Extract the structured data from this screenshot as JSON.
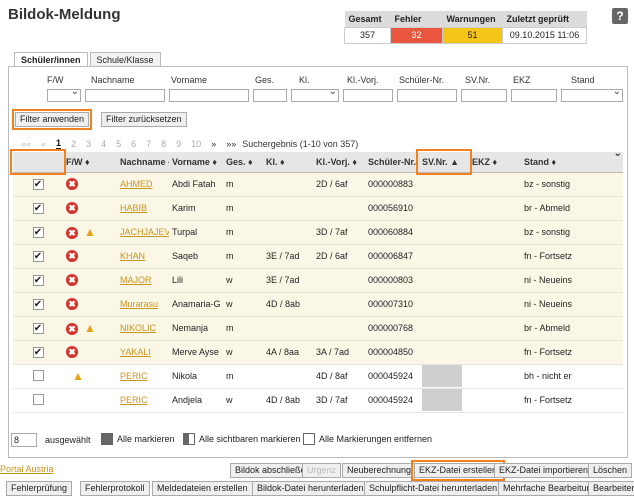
{
  "title": "Bildok-Meldung",
  "stats": {
    "headers": [
      "Gesamt",
      "Fehler",
      "Warnungen",
      "Zuletzt geprüft"
    ],
    "values": [
      "357",
      "32",
      "51",
      "09.10.2015 11:06"
    ],
    "colors": {
      "error": "#e9573f",
      "warning": "#f5c518"
    }
  },
  "help_label": "?",
  "tabs": [
    "Schüler/innen",
    "Schule/Klasse"
  ],
  "filters": {
    "labels": [
      "F/W",
      "Nachname",
      "Vorname",
      "Ges.",
      "Kl.",
      "Kl.-Vorj.",
      "Schüler-Nr.",
      "SV.Nr.",
      "EKZ",
      "Stand"
    ],
    "apply_label": "Filter anwenden",
    "reset_label": "Filter zurücksetzen"
  },
  "pager": {
    "first": "««",
    "prev": "«",
    "pages": [
      "1",
      "2",
      "3",
      "4",
      "5",
      "6",
      "7",
      "8",
      "9",
      "10"
    ],
    "next": "»",
    "last": "»»",
    "result": "Suchergebnis (1-10 von 357)"
  },
  "table": {
    "columns": [
      "",
      "F/W ♦",
      "Nachname ♦",
      "Vorname ♦",
      "Ges. ♦",
      "Kl. ♦",
      "Kl.-Vorj. ♦",
      "Schüler-Nr. ♦",
      "SV.Nr. ▲",
      "EKZ ♦",
      "Stand ♦"
    ],
    "rows": [
      {
        "checked": "✔",
        "err": "✖",
        "warn": "",
        "nachname": "AHMED",
        "vorname": "Abdi Fatah",
        "ges": "m",
        "kl": "",
        "vorj": "2D / 6af",
        "nr": "000000883",
        "sv": "",
        "ekz": "",
        "stand": "bz - sonstig"
      },
      {
        "checked": "✔",
        "err": "✖",
        "warn": "",
        "nachname": "HABIB",
        "vorname": "Karim",
        "ges": "m",
        "kl": "",
        "vorj": "",
        "nr": "000056910",
        "sv": "",
        "ekz": "",
        "stand": "br - Abmeld"
      },
      {
        "checked": "✔",
        "err": "✖",
        "warn": "▲",
        "nachname": "JACHJAJEV",
        "vorname": "Turpal",
        "ges": "m",
        "kl": "",
        "vorj": "3D / 7af",
        "nr": "000060884",
        "sv": "",
        "ekz": "",
        "stand": "bz - sonstig"
      },
      {
        "checked": "✔",
        "err": "✖",
        "warn": "",
        "nachname": "KHAN",
        "vorname": "Saqeb",
        "ges": "m",
        "kl": "3E / 7ad",
        "vorj": "2D / 6af",
        "nr": "000006847",
        "sv": "",
        "ekz": "",
        "stand": "fn - Fortsetz"
      },
      {
        "checked": "✔",
        "err": "✖",
        "warn": "",
        "nachname": "MAJOR",
        "vorname": "Lili",
        "ges": "w",
        "kl": "3E / 7ad",
        "vorj": "",
        "nr": "000000803",
        "sv": "",
        "ekz": "",
        "stand": "ni - Neueins"
      },
      {
        "checked": "✔",
        "err": "✖",
        "warn": "",
        "nachname": "Murarasu",
        "vorname": "Anamaria-G",
        "ges": "w",
        "kl": "4D / 8ab",
        "vorj": "",
        "nr": "000007310",
        "sv": "",
        "ekz": "",
        "stand": "ni - Neueins"
      },
      {
        "checked": "✔",
        "err": "✖",
        "warn": "▲",
        "nachname": "NIKOLIC",
        "vorname": "Nemanja",
        "ges": "m",
        "kl": "",
        "vorj": "",
        "nr": "000000768",
        "sv": "",
        "ekz": "",
        "stand": "br - Abmeld"
      },
      {
        "checked": "✔",
        "err": "✖",
        "warn": "",
        "nachname": "YAKALI",
        "vorname": "Merve Ayse",
        "ges": "w",
        "kl": "4A / 8aa",
        "vorj": "3A / 7ad",
        "nr": "000004850",
        "sv": "",
        "ekz": "",
        "stand": "fn - Fortsetz"
      },
      {
        "checked": "",
        "err": "",
        "warn": "▲",
        "nachname": "PERIC",
        "vorname": "Nikola",
        "ges": "m",
        "kl": "",
        "vorj": "4D / 8af",
        "nr": "000045924",
        "sv": "",
        "ekz": "",
        "stand": "bh - nicht er"
      },
      {
        "checked": "",
        "err": "",
        "warn": "",
        "nachname": "PERIC",
        "vorname": "Andjela",
        "ges": "w",
        "kl": "4D / 8ab",
        "vorj": "3D / 7af",
        "nr": "000045924",
        "sv": "",
        "ekz": "",
        "stand": "fn - Fortsetz"
      }
    ]
  },
  "footer": {
    "selected_count": "8",
    "selected_label": "ausgewählt",
    "mark_all": "Alle markieren",
    "mark_visible": "Alle sichtbaren markieren",
    "unmark_all": "Alle Markierungen entfernen"
  },
  "actions1": {
    "portal": "Portal Austria",
    "abschliessen": "Bildok abschließen",
    "urgenz": "Urgenz",
    "neuberechnung": "Neuberechnung",
    "ekz_erstellen": "EKZ-Datei erstellen",
    "ekz_import": "EKZ-Datei importieren",
    "loeschen": "Löschen"
  },
  "actions2": [
    "Fehlerprüfung",
    "Fehlerprotokoll",
    "Meldedateien erstellen",
    "Bildok-Datei herunterladen",
    "Schulpflicht-Datei herunterladen",
    "Mehrfache Bearbeitung",
    "Bearbeiten"
  ],
  "accent": "#f08020"
}
